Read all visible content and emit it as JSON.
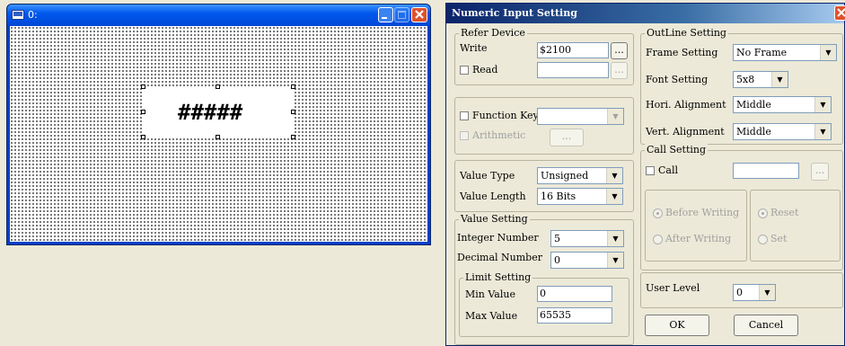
{
  "editor": {
    "title": "0:",
    "display_text": "#####",
    "window_controls": [
      "minimize",
      "maximize",
      "close"
    ]
  },
  "dialog": {
    "title": "Numeric Input Setting",
    "refer_device": {
      "legend": "Refer Device",
      "write_label": "Write",
      "write_value": "$2100",
      "write_browse": "...",
      "read_label": "Read",
      "read_value": "",
      "read_browse": "..."
    },
    "function_key": {
      "label": "Function Key",
      "value": "",
      "arithmetic_label": "Arithmetic",
      "arithmetic_button": "..."
    },
    "value_type": {
      "type_label": "Value Type",
      "type_value": "Unsigned",
      "length_label": "Value Length",
      "length_value": "16 Bits"
    },
    "value_setting": {
      "legend": "Value Setting",
      "integer_label": "Integer Number",
      "integer_value": "5",
      "decimal_label": "Decimal Number",
      "decimal_value": "0"
    },
    "limit_setting": {
      "legend": "Limit Setting",
      "min_label": "Min Value",
      "min_value": "0",
      "max_label": "Max Value",
      "max_value": "65535"
    },
    "outline_setting": {
      "legend": "OutLine Setting",
      "frame_label": "Frame Setting",
      "frame_value": "No Frame",
      "font_label": "Font Setting",
      "font_value": "5x8",
      "hori_label": "Hori. Alignment",
      "hori_value": "Middle",
      "vert_label": "Vert. Alignment",
      "vert_value": "Middle"
    },
    "call_setting": {
      "legend": "Call Setting",
      "call_label": "Call",
      "call_value": "",
      "call_browse": "...",
      "before_writing": "Before Writing",
      "after_writing": "After Writing",
      "reset": "Reset",
      "set": "Set"
    },
    "user_level": {
      "label": "User Level",
      "value": "0"
    },
    "ok_label": "OK",
    "cancel_label": "Cancel"
  },
  "colors": {
    "titlebar": "#0a246a",
    "face": "#ece9d8",
    "editor_canvas": "#ffffff",
    "dot_grid": "#000000"
  }
}
